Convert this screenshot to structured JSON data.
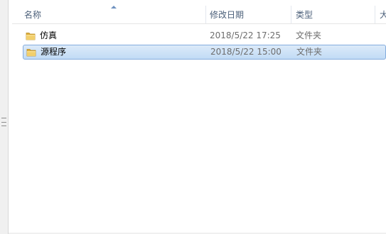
{
  "columns": {
    "name": "名称",
    "date_modified": "修改日期",
    "type": "类型",
    "size": "大"
  },
  "sort": {
    "column": "name",
    "direction": "ascending"
  },
  "files": [
    {
      "name": "仿真",
      "date_modified": "2018/5/22 17:25",
      "type": "文件夹",
      "icon": "folder-icon",
      "selected": false
    },
    {
      "name": "源程序",
      "date_modified": "2018/5/22 15:00",
      "type": "文件夹",
      "icon": "folder-icon",
      "selected": true
    }
  ],
  "colors": {
    "selection_fill": "#c9e0f7",
    "selection_border": "#84acdd",
    "header_text": "#4c607a",
    "folder": "#e8c15a"
  }
}
